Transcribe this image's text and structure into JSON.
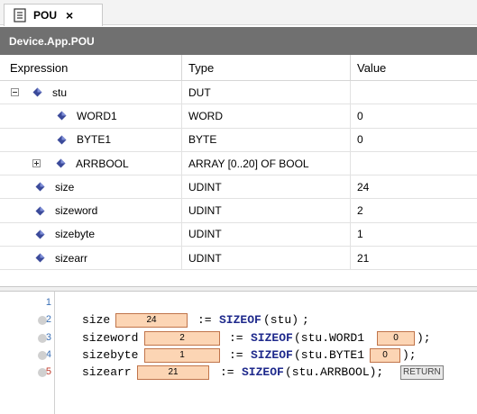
{
  "tab": {
    "label": "POU",
    "close": "×"
  },
  "header": {
    "title": "Device.App.POU"
  },
  "grid": {
    "columns": {
      "expression": "Expression",
      "type": "Type",
      "value": "Value"
    },
    "rows": [
      {
        "expr": "stu",
        "type": "DUT",
        "value": ""
      },
      {
        "expr": "WORD1",
        "type": "WORD",
        "value": "0"
      },
      {
        "expr": "BYTE1",
        "type": "BYTE",
        "value": "0"
      },
      {
        "expr": "ARRBOOL",
        "type": "ARRAY [0..20] OF BOOL",
        "value": ""
      },
      {
        "expr": "size",
        "type": "UDINT",
        "value": "24"
      },
      {
        "expr": "sizeword",
        "type": "UDINT",
        "value": "2"
      },
      {
        "expr": "sizebyte",
        "type": "UDINT",
        "value": "1"
      },
      {
        "expr": "sizearr",
        "type": "UDINT",
        "value": "21"
      }
    ]
  },
  "editor": {
    "line_numbers": [
      "1",
      "2",
      "3",
      "4",
      "5"
    ],
    "lines": [
      {
        "var": "size",
        "assign": ":=",
        "func": "SIZEOF",
        "arg": "(stu)",
        "end": ";",
        "inline_value": "24"
      },
      {
        "var": "sizeword",
        "assign": ":=",
        "func": "SIZEOF",
        "arg": "(stu.WORD1",
        "end": ");",
        "inline_value": "2",
        "arg_value": "0"
      },
      {
        "var": "sizebyte",
        "assign": ":=",
        "func": "SIZEOF",
        "arg": "(stu.BYTE1",
        "end": ");",
        "inline_value": "1",
        "arg_value": "0"
      },
      {
        "var": "sizearr",
        "assign": ":=",
        "func": "SIZEOF",
        "arg": "(stu.ARRBOOL);",
        "inline_value": "21",
        "return_label": "RETURN"
      }
    ]
  },
  "colors": {
    "header_bg": "#707070",
    "inline_value_bg": "#fcd5b4",
    "keyword": "#1f2a8c",
    "line_number": "#3a6fb5",
    "line_number_current": "#c0392b"
  },
  "icons": {
    "tab": "document-icon",
    "variable": "variable-diamond-icon",
    "expand": "expand-plus-icon",
    "collapse": "collapse-minus-icon",
    "breakpoint": "breakpoint-dot-icon"
  }
}
